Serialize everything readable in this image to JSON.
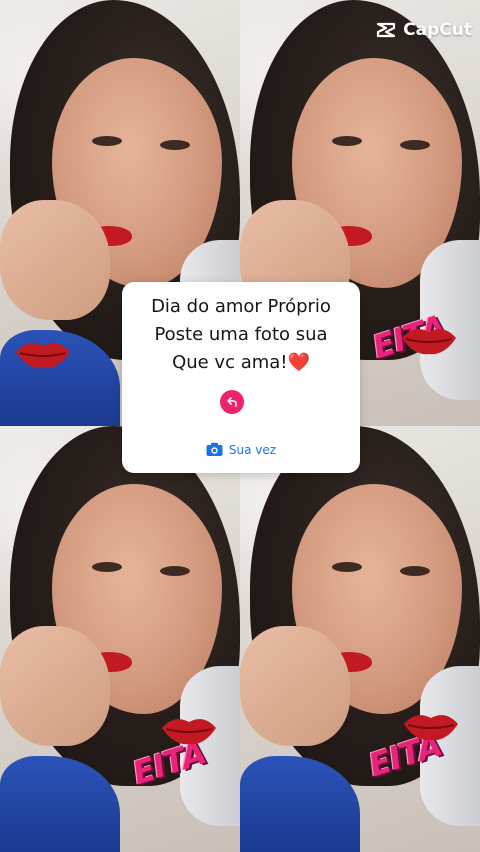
{
  "watermark": {
    "text": "CapCut",
    "icon": "capcut-logo-icon"
  },
  "card": {
    "line1": "Dia do amor Próprio",
    "line2": "Poste uma foto sua",
    "line3_text": "Que vc ama!",
    "line3_emoji": "❤️",
    "reply_icon": "reply-arrow-icon",
    "cta_icon": "camera-icon",
    "cta_label": "Sua vez"
  },
  "stickers": {
    "eita": "EITA",
    "kiss_icon": "kiss-lips-icon"
  },
  "colors": {
    "accent_pink": "#f0226b",
    "link_blue": "#1a73e8",
    "sticker_pink": "#e8247a",
    "lip_red": "#c11a22"
  }
}
